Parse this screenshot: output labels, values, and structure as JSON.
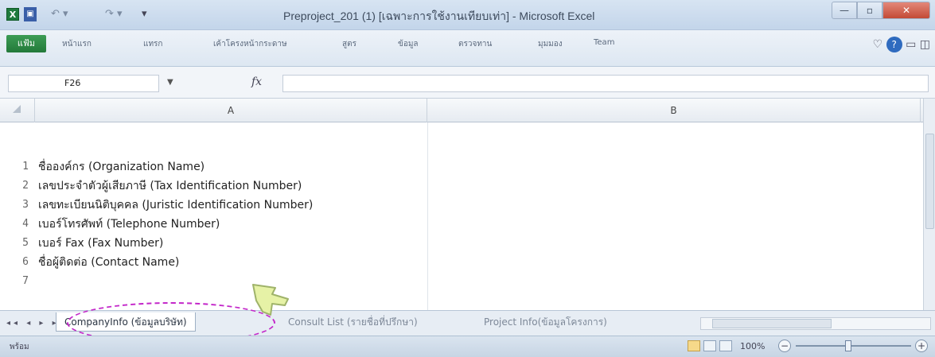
{
  "window": {
    "title": "Preproject_201 (1) [เฉพาะการใช้งานเทียบเท่า] - Microsoft Excel",
    "controls": {
      "minimize": "—",
      "maximize": "▫",
      "close": "✕"
    }
  },
  "qat": {
    "save": "▣",
    "undo": "↶ ▾",
    "redo": "↷ ▾",
    "more": "▾"
  },
  "ribbon": {
    "file_tab": "แฟ้ม",
    "tabs": [
      "หน้าแรก",
      "แทรก",
      "เค้าโครงหน้ากระดาษ",
      "สูตร",
      "ข้อมูล",
      "ตรวจทาน",
      "มุมมอง",
      "Team"
    ]
  },
  "formula_bar": {
    "name_box": "F26",
    "fx": "fx",
    "value": ""
  },
  "columns": [
    "A",
    "B"
  ],
  "rows": [
    {
      "num": "1",
      "a": "ชื่อองค์กร  (Organization Name)"
    },
    {
      "num": "2",
      "a": "เลขประจำตัวผู้เสียภาษี  (Tax Identification Number)"
    },
    {
      "num": "3",
      "a": "เลขทะเบียนนิติบุคคล  (Juristic Identification Number)"
    },
    {
      "num": "4",
      "a": "เบอร์โทรศัพท์  (Telephone Number)"
    },
    {
      "num": "5",
      "a": "เบอร์  Fax (Fax Number)"
    },
    {
      "num": "6",
      "a": "ชื่อผู้ติดต่อ  (Contact Name)"
    },
    {
      "num": "7",
      "a": ""
    }
  ],
  "sheet_tabs": {
    "nav": "◂◂ ◂ ▸ ▸▸",
    "tabs": [
      "CompanyInfo (ข้อมูลบริษัท)",
      "Consult List (รายชื่อที่ปรึกษา)",
      "Project Info(ข้อมูลโครงการ)"
    ],
    "active_index": 0
  },
  "status_bar": {
    "ready": "พร้อม",
    "zoom": "100%",
    "zoom_minus": "−",
    "zoom_plus": "+"
  },
  "colors": {
    "highlight": "#c326c9",
    "excel_green": "#1f7a3d"
  }
}
